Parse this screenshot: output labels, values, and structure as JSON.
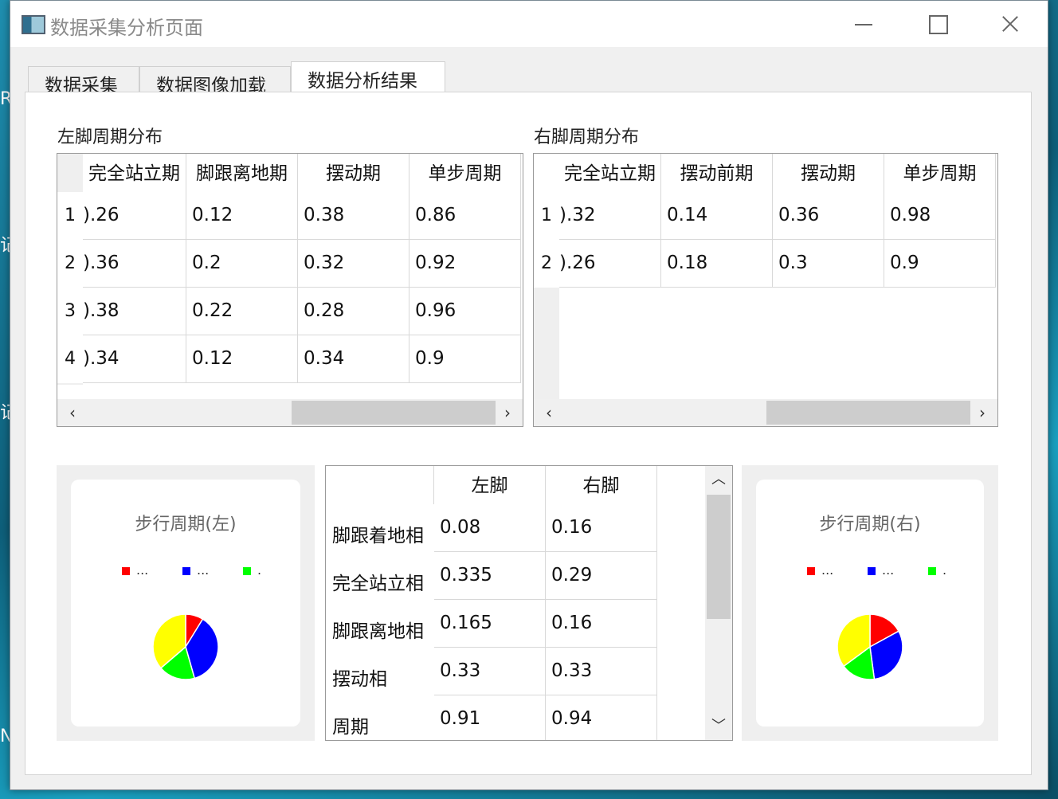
{
  "window": {
    "title": "数据采集分析页面"
  },
  "desktop": {
    "edge_chars": [
      "R",
      "记",
      "记",
      "N"
    ]
  },
  "tabs": [
    {
      "label": "数据采集",
      "active": false
    },
    {
      "label": "数据图像加载",
      "active": false
    },
    {
      "label": "数据分析结果",
      "active": true
    }
  ],
  "left_table": {
    "title": "左脚周期分布",
    "columns": [
      "完全站立期",
      "脚跟离地期",
      "摆动期",
      "单步周期"
    ],
    "row_headers": [
      "1",
      "2",
      "3",
      "4"
    ],
    "rows": [
      [
        ").26",
        "0.12",
        "0.38",
        "0.86"
      ],
      [
        ").36",
        "0.2",
        "0.32",
        "0.92"
      ],
      [
        ").38",
        "0.22",
        "0.28",
        "0.96"
      ],
      [
        ").34",
        "0.12",
        "0.34",
        "0.9"
      ]
    ]
  },
  "right_table": {
    "title": "右脚周期分布",
    "columns": [
      "完全站立期",
      "摆动前期",
      "摆动期",
      "单步周期"
    ],
    "row_headers": [
      "1",
      "2"
    ],
    "rows": [
      [
        ").32",
        "0.14",
        "0.36",
        "0.98"
      ],
      [
        ").26",
        "0.18",
        "0.3",
        "0.9"
      ]
    ]
  },
  "summary_table": {
    "columns": [
      "左脚",
      "右脚"
    ],
    "rows": [
      {
        "label": "脚跟着地相",
        "left": "0.08",
        "right": "0.16"
      },
      {
        "label": "完全站立相",
        "left": "0.335",
        "right": "0.29"
      },
      {
        "label": "脚跟离地相",
        "left": "0.165",
        "right": "0.16"
      },
      {
        "label": "摆动相",
        "left": "0.33",
        "right": "0.33"
      },
      {
        "label": "周期",
        "left": "0.91",
        "right": "0.94"
      }
    ]
  },
  "chart_data": [
    {
      "type": "pie",
      "title": "步行周期(左)",
      "legend": [
        {
          "label": "...",
          "color": "#ff0000"
        },
        {
          "label": "...",
          "color": "#0000ff"
        },
        {
          "label": ".",
          "color": "#00ff00"
        }
      ],
      "slices": [
        {
          "value": 0.08,
          "color": "#ff0000"
        },
        {
          "value": 0.335,
          "color": "#0000ff"
        },
        {
          "value": 0.165,
          "color": "#00ff00"
        },
        {
          "value": 0.33,
          "color": "#ffff00"
        }
      ]
    },
    {
      "type": "pie",
      "title": "步行周期(右)",
      "legend": [
        {
          "label": "...",
          "color": "#ff0000"
        },
        {
          "label": "...",
          "color": "#0000ff"
        },
        {
          "label": ".",
          "color": "#00ff00"
        }
      ],
      "slices": [
        {
          "value": 0.16,
          "color": "#ff0000"
        },
        {
          "value": 0.29,
          "color": "#0000ff"
        },
        {
          "value": 0.16,
          "color": "#00ff00"
        },
        {
          "value": 0.33,
          "color": "#ffff00"
        }
      ]
    }
  ]
}
